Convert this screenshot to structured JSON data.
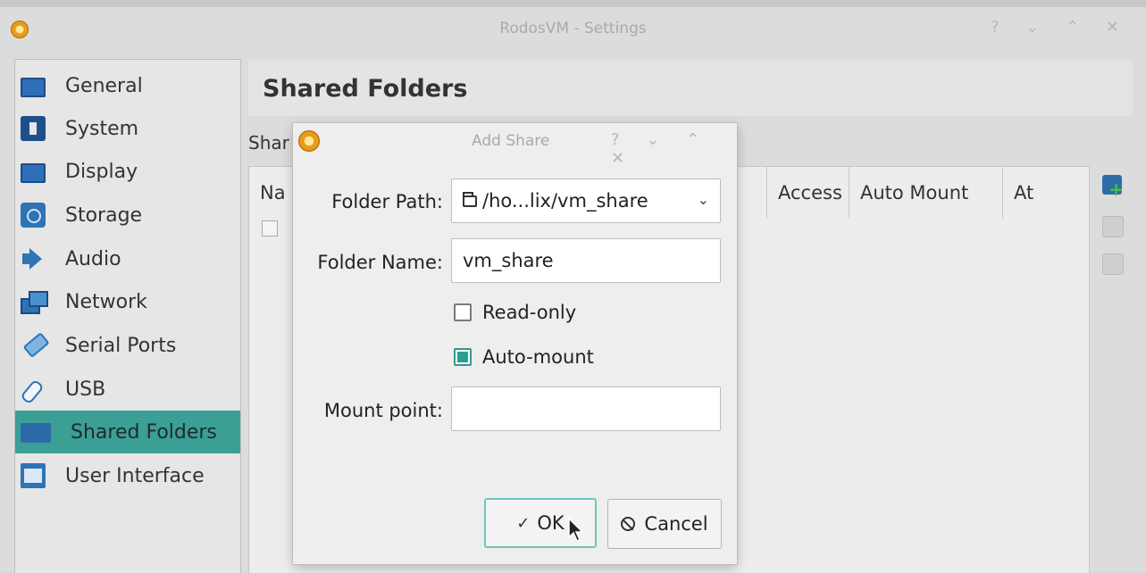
{
  "window": {
    "title": "RodosVM - Settings",
    "controls": [
      "?",
      "⌄",
      "⌃",
      "✕"
    ]
  },
  "sidebar": {
    "items": [
      {
        "label": "General",
        "icon": "monitor-icon"
      },
      {
        "label": "System",
        "icon": "system-icon"
      },
      {
        "label": "Display",
        "icon": "display-icon"
      },
      {
        "label": "Storage",
        "icon": "storage-icon"
      },
      {
        "label": "Audio",
        "icon": "audio-icon"
      },
      {
        "label": "Network",
        "icon": "network-icon"
      },
      {
        "label": "Serial Ports",
        "icon": "serial-ports-icon"
      },
      {
        "label": "USB",
        "icon": "usb-icon"
      },
      {
        "label": "Shared Folders",
        "icon": "shared-folders-icon",
        "selected": true
      },
      {
        "label": "User Interface",
        "icon": "user-interface-icon"
      }
    ]
  },
  "main": {
    "title": "Shared Folders",
    "section_label": "Shar",
    "table": {
      "columns": [
        "Na",
        "Access",
        "Auto Mount",
        "At"
      ]
    }
  },
  "dialog": {
    "title": "Add Share",
    "controls": [
      "?",
      "⌄",
      "⌃",
      "✕"
    ],
    "folder_path_label": "Folder Path:",
    "folder_path_value": "/ho...lix/vm_share",
    "folder_name_label": "Folder Name:",
    "folder_name_value": "vm_share",
    "read_only_label": "Read-only",
    "read_only_checked": false,
    "auto_mount_label": "Auto-mount",
    "auto_mount_checked": true,
    "mount_point_label": "Mount point:",
    "mount_point_value": "",
    "ok_label": "OK",
    "cancel_label": "Cancel"
  },
  "colors": {
    "accent": "#3b9f96",
    "checkbox_accent": "#2e9c8f",
    "ok_border": "#6ec6bd"
  }
}
